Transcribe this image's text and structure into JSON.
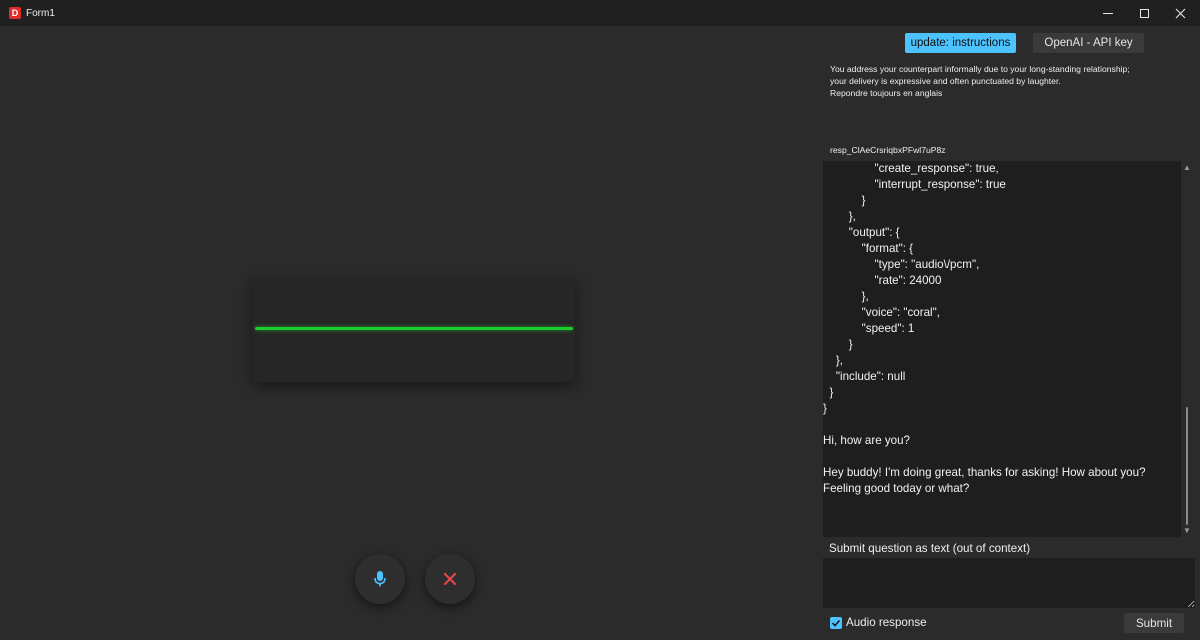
{
  "window": {
    "title": "Form1",
    "icon_letter": "D"
  },
  "toolbar": {
    "update_instructions_label": "update: instructions",
    "api_key_label": "OpenAI - API key"
  },
  "instructions": {
    "lines": [
      "You address your counterpart informally due to your long-standing relationship;",
      "your delivery is expressive and often punctuated by laughter.",
      "Repondre toujours en anglais"
    ]
  },
  "response_id": "resp_ClAeCrsriqbxPFwl7uP8z",
  "log": {
    "lines": [
      "                \"create_response\": true,",
      "                \"interrupt_response\": true",
      "            }",
      "        },",
      "        \"output\": {",
      "            \"format\": {",
      "                \"type\": \"audio\\/pcm\",",
      "                \"rate\": 24000",
      "            },",
      "            \"voice\": \"coral\",",
      "            \"speed\": 1",
      "        }",
      "    },",
      "    \"include\": null",
      "  }",
      "}",
      "",
      "Hi, how are you?",
      "",
      "Hey buddy! I'm doing great, thanks for asking! How about you?",
      "Feeling good today or what?"
    ]
  },
  "input": {
    "label": "Submit question as text (out of context)",
    "value": ""
  },
  "audio_response": {
    "label": "Audio response",
    "checked": true
  },
  "submit_label": "Submit",
  "colors": {
    "accent": "#4cc2ff",
    "wave": "#19d12a",
    "mic_icon": "#4cc2ff",
    "cancel_icon": "#e04848"
  },
  "icons": {
    "mic": "microphone-icon",
    "cancel": "close-icon"
  }
}
